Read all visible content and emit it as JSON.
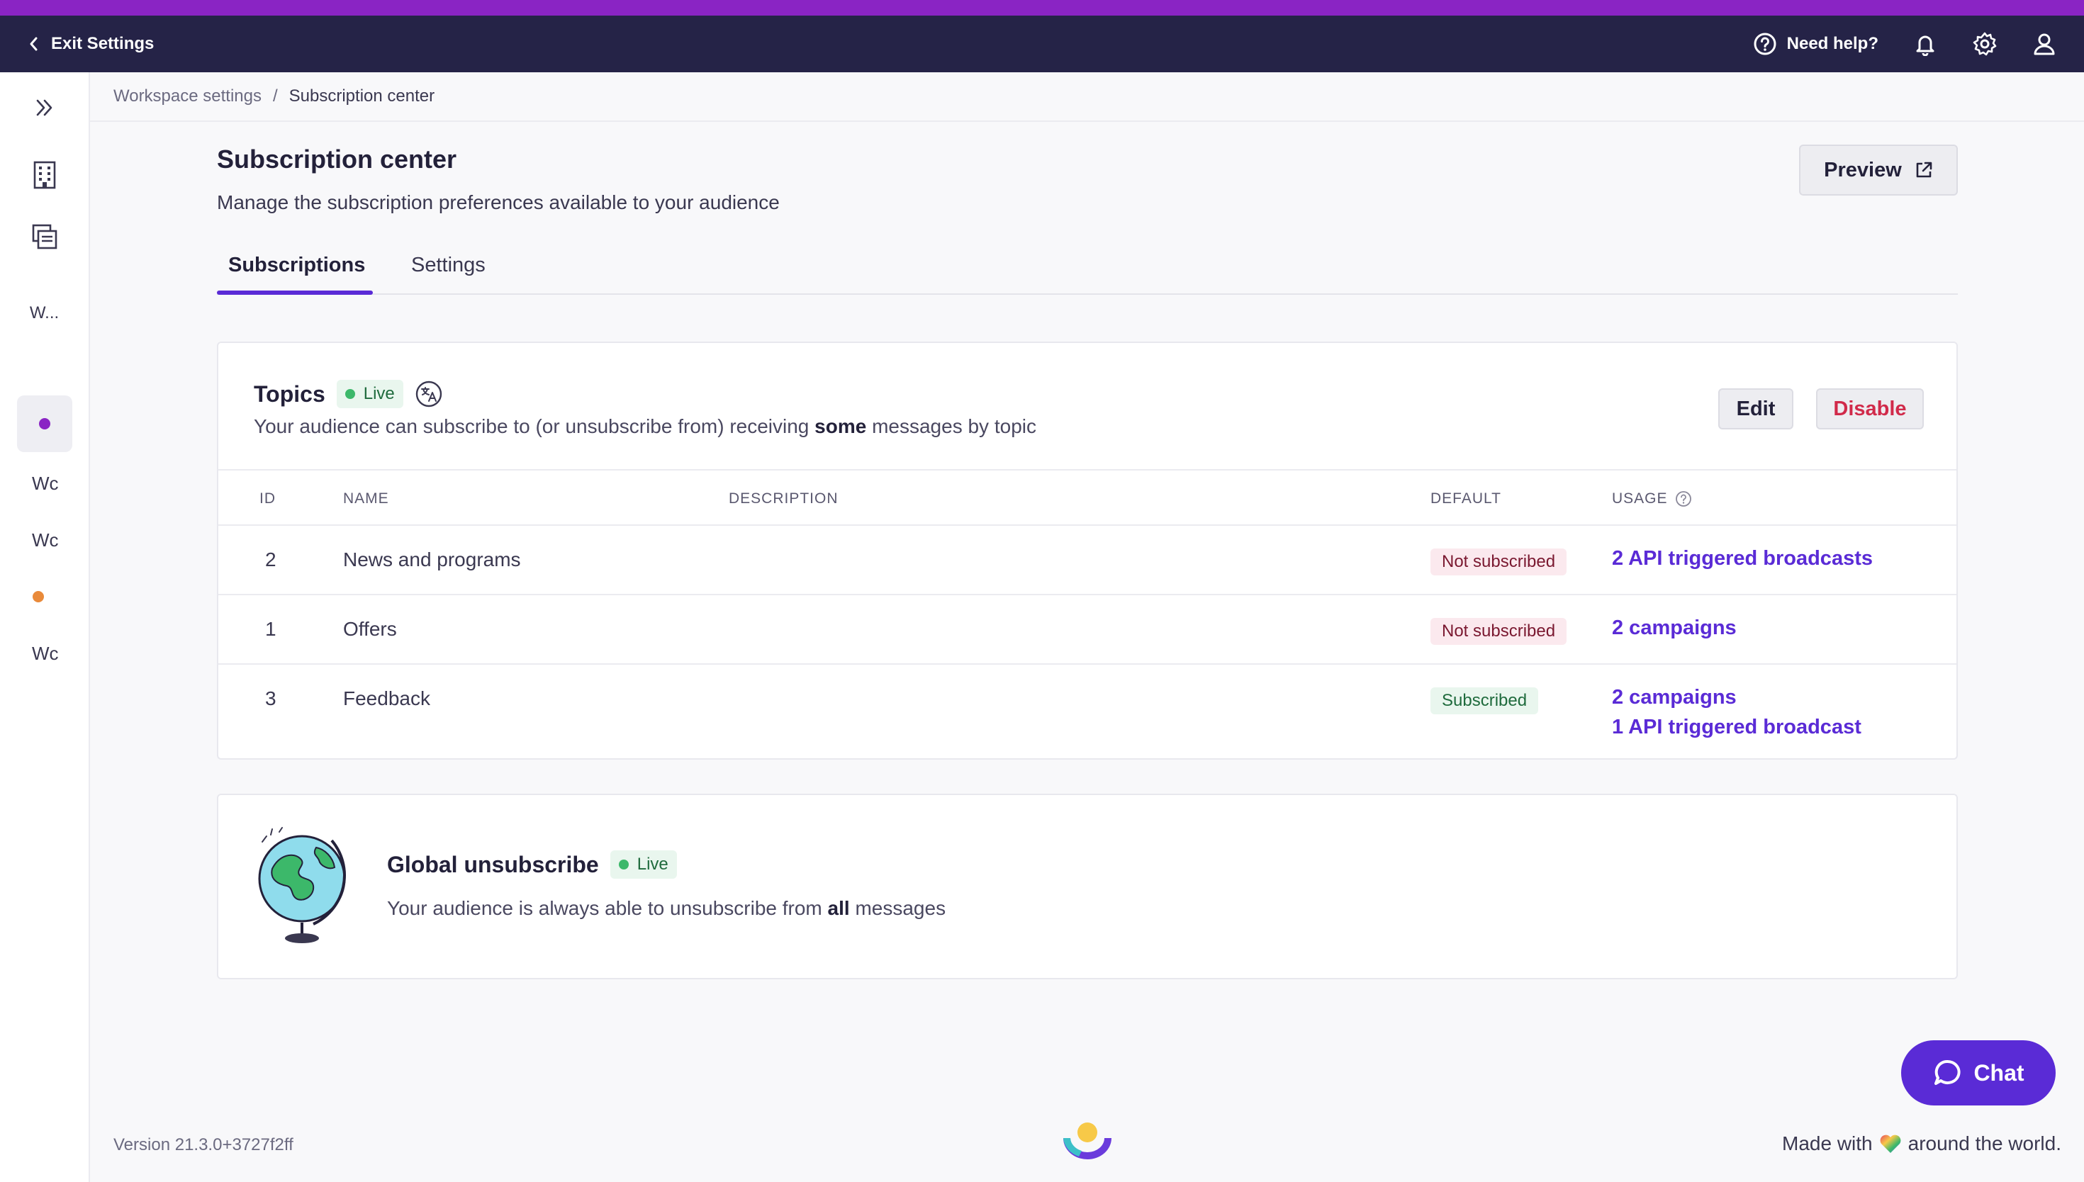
{
  "topbar": {
    "exit_label": "Exit Settings",
    "help_label": "Need help?"
  },
  "sidebar": {
    "items": [
      {
        "label": "W..."
      },
      {
        "label": "Wc"
      },
      {
        "label": "Wc"
      },
      {
        "label": "Wc"
      }
    ],
    "dot_colors": [
      "#8a24c4",
      "#e98a3a"
    ]
  },
  "breadcrumb": {
    "parent": "Workspace settings",
    "separator": "/",
    "current": "Subscription center"
  },
  "page": {
    "title": "Subscription center",
    "subtitle": "Manage the subscription preferences available to your audience",
    "preview_label": "Preview"
  },
  "tabs": [
    {
      "label": "Subscriptions",
      "active": true
    },
    {
      "label": "Settings",
      "active": false
    }
  ],
  "topics": {
    "title": "Topics",
    "status": "Live",
    "desc_before": "Your audience can subscribe to (or unsubscribe from) receiving ",
    "desc_bold": "some",
    "desc_after": " messages by topic",
    "edit_label": "Edit",
    "disable_label": "Disable",
    "columns": {
      "id": "ID",
      "name": "NAME",
      "description": "DESCRIPTION",
      "default": "DEFAULT",
      "usage": "USAGE"
    },
    "rows": [
      {
        "id": "2",
        "name": "News and programs",
        "default": "Not subscribed",
        "usage": [
          "2 API triggered broadcasts"
        ]
      },
      {
        "id": "1",
        "name": "Offers",
        "default": "Not subscribed",
        "usage": [
          "2 campaigns"
        ]
      },
      {
        "id": "3",
        "name": "Feedback",
        "default": "Subscribed",
        "usage": [
          "2 campaigns",
          "1 API triggered broadcast"
        ]
      }
    ]
  },
  "global": {
    "title": "Global unsubscribe",
    "status": "Live",
    "desc_before": "Your audience is always able to unsubscribe from ",
    "desc_bold": "all",
    "desc_after": " messages"
  },
  "chat": {
    "label": "Chat"
  },
  "footer": {
    "version": "Version 21.3.0+3727f2ff",
    "made_before": "Made with",
    "made_after": "around the world."
  },
  "colors": {
    "accent": "#5a2bd6",
    "topbar": "#252347",
    "brand_bar": "#8a24c4",
    "danger": "#d12a4a",
    "live": "#3cb86a"
  }
}
